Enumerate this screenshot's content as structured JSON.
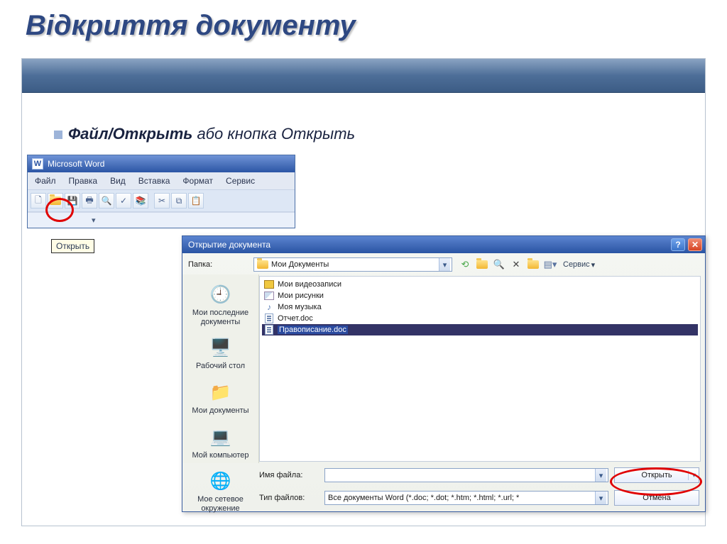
{
  "slide": {
    "title": "Відкриття документу",
    "instruction_prefix": "Файл/Открыть",
    "instruction_suffix": "  або кнопка Открыть"
  },
  "word": {
    "app_title": "Microsoft Word",
    "menu": [
      "Файл",
      "Правка",
      "Вид",
      "Вставка",
      "Формат",
      "Сервис"
    ],
    "tooltip": "Открыть"
  },
  "dialog": {
    "title": "Открытие документа",
    "folder_label": "Папка:",
    "folder_value": "Мои Документы",
    "service_label": "Сервис",
    "places": [
      "Мои последние документы",
      "Рабочий стол",
      "Мои документы",
      "Мой компьютер",
      "Мое сетевое окружение"
    ],
    "files": [
      {
        "type": "folder-video",
        "name": "Мои видеозаписи"
      },
      {
        "type": "folder-pic",
        "name": "Мои рисунки"
      },
      {
        "type": "folder-music",
        "name": "Моя музыка"
      },
      {
        "type": "doc",
        "name": "Отчет.doc"
      },
      {
        "type": "doc",
        "name": "Правописание.doc",
        "selected": true
      }
    ],
    "filename_label": "Имя файла:",
    "filename_value": "",
    "filetype_label": "Тип файлов:",
    "filetype_value": "Все документы Word (*.doc; *.dot; *.htm; *.html; *.url; *",
    "open_btn": "Открыть",
    "cancel_btn": "Отмена"
  }
}
